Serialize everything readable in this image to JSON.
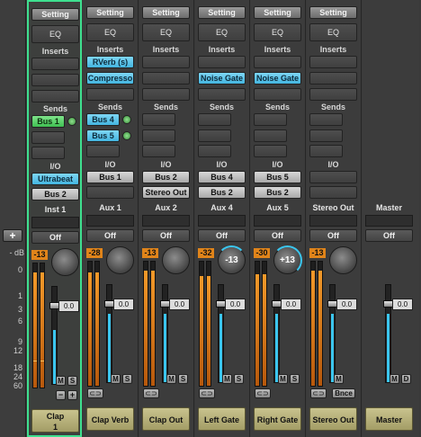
{
  "controls": {
    "add": "+",
    "db_label": "- dB"
  },
  "scale": [
    "0",
    "1",
    "3",
    "6",
    "9",
    "12",
    "18",
    "24",
    "60"
  ],
  "channels": [
    {
      "setting": "Setting",
      "eq": "EQ",
      "inserts_header": "Inserts",
      "inserts": [
        "",
        "",
        ""
      ],
      "sends_header": "Sends",
      "sends": [
        {
          "label": "Bus 1",
          "style": "green"
        },
        {
          "label": ""
        },
        {
          "label": ""
        }
      ],
      "io_header": "I/O",
      "input": "Ultrabeat",
      "output": "Bus 2",
      "name": "Inst 1",
      "automation": "Off",
      "peak": "-13",
      "gain": "0.0",
      "track_name_line1": "Clap",
      "track_name_line2": "1",
      "buttons": [
        "M",
        "S"
      ],
      "mini": [
        "−",
        "+"
      ]
    },
    {
      "setting": "Setting",
      "eq": "EQ",
      "inserts_header": "Inserts",
      "inserts": [
        "RVerb (s)",
        "Compresso",
        ""
      ],
      "sends_header": "Sends",
      "sends": [
        {
          "label": "Bus 4",
          "style": "cyan"
        },
        {
          "label": "Bus 5",
          "style": "cyan"
        },
        {
          "label": ""
        }
      ],
      "io_header": "I/O",
      "input": "Bus 1",
      "output": "",
      "name": "Aux 1",
      "automation": "Off",
      "peak": "-28",
      "gain": "0.0",
      "track_name": "Clap Verb",
      "buttons": [
        "M",
        "S"
      ],
      "link_icon": "link-icon"
    },
    {
      "setting": "Setting",
      "eq": "EQ",
      "inserts_header": "Inserts",
      "inserts": [
        "",
        "",
        ""
      ],
      "sends_header": "Sends",
      "sends": [
        {
          "label": ""
        },
        {
          "label": ""
        },
        {
          "label": ""
        }
      ],
      "io_header": "I/O",
      "input": "Bus 2",
      "output": "Stereo Out",
      "name": "Aux 2",
      "automation": "Off",
      "peak": "-13",
      "gain": "0.0",
      "track_name": "Clap Out",
      "buttons": [
        "M",
        "S"
      ],
      "link_icon": "link-icon"
    },
    {
      "setting": "Setting",
      "eq": "EQ",
      "inserts_header": "Inserts",
      "inserts": [
        "Noise Gate",
        "",
        ""
      ],
      "sends_header": "Sends",
      "sends": [
        {
          "label": ""
        },
        {
          "label": ""
        },
        {
          "label": ""
        }
      ],
      "io_header": "I/O",
      "input": "Bus 4",
      "output": "Bus 2",
      "name": "Aux 4",
      "automation": "Off",
      "peak": "-32",
      "pan": "-13",
      "gain": "0.0",
      "track_name": "Left Gate",
      "buttons": [
        "M",
        "S"
      ],
      "link_icon": "link-icon"
    },
    {
      "setting": "Setting",
      "eq": "EQ",
      "inserts_header": "Inserts",
      "inserts": [
        "Noise Gate",
        "",
        ""
      ],
      "sends_header": "Sends",
      "sends": [
        {
          "label": ""
        },
        {
          "label": ""
        },
        {
          "label": ""
        }
      ],
      "io_header": "I/O",
      "input": "Bus 5",
      "output": "Bus 2",
      "name": "Aux 5",
      "automation": "Off",
      "peak": "-30",
      "pan": "+13",
      "gain": "0.0",
      "track_name": "Right Gate",
      "buttons": [
        "M",
        "S"
      ],
      "link_icon": "link-icon"
    },
    {
      "setting": "Setting",
      "eq": "EQ",
      "inserts_header": "Inserts",
      "inserts": [
        "",
        "",
        ""
      ],
      "sends_header": "Sends",
      "sends": [
        {
          "label": ""
        },
        {
          "label": ""
        },
        {
          "label": ""
        }
      ],
      "io_header": "I/O",
      "input": "",
      "output": "",
      "name": "Stereo Out",
      "automation": "Off",
      "peak": "-13",
      "gain": "0.0",
      "track_name": "Stereo Out",
      "buttons": [
        "M"
      ],
      "link_icon": "link-icon",
      "bounce": "Bnce"
    },
    {
      "name": "Master",
      "automation": "Off",
      "gain": "0.0",
      "track_name": "Master",
      "buttons": [
        "M",
        "D"
      ]
    }
  ],
  "colors": {
    "selected_outline": "#3ee08f",
    "plugin": "#44b5df",
    "send_green": "#3fbf52",
    "meter": "#e0841a",
    "label": "#c9c38e"
  }
}
